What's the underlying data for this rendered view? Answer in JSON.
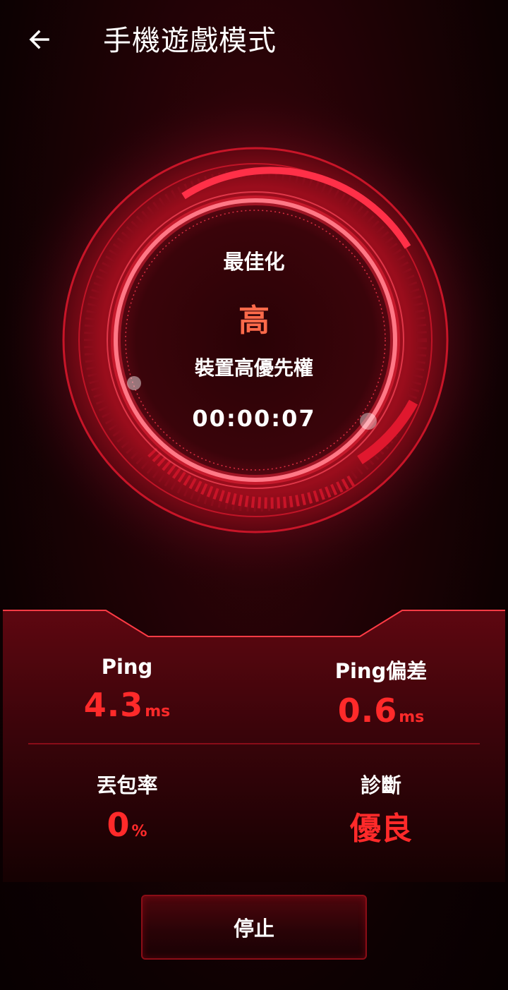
{
  "header": {
    "title": "手機遊戲模式",
    "back_icon": "arrow-left-icon"
  },
  "dial": {
    "label": "最佳化",
    "level": "高",
    "priority": "裝置高優先權",
    "timer": "00:00:07"
  },
  "stats": {
    "ping": {
      "label": "Ping",
      "value": "4.3",
      "unit": "ms"
    },
    "ping_deviation": {
      "label": "Ping偏差",
      "value": "0.6",
      "unit": "ms"
    },
    "packet_loss": {
      "label": "丟包率",
      "value": "0",
      "unit": "%"
    },
    "diagnosis": {
      "label": "診斷",
      "value": "優良"
    }
  },
  "actions": {
    "stop_label": "停止"
  },
  "colors": {
    "accent": "#ff2a2a",
    "level": "#ff6a4a",
    "background": "#1e0205"
  }
}
